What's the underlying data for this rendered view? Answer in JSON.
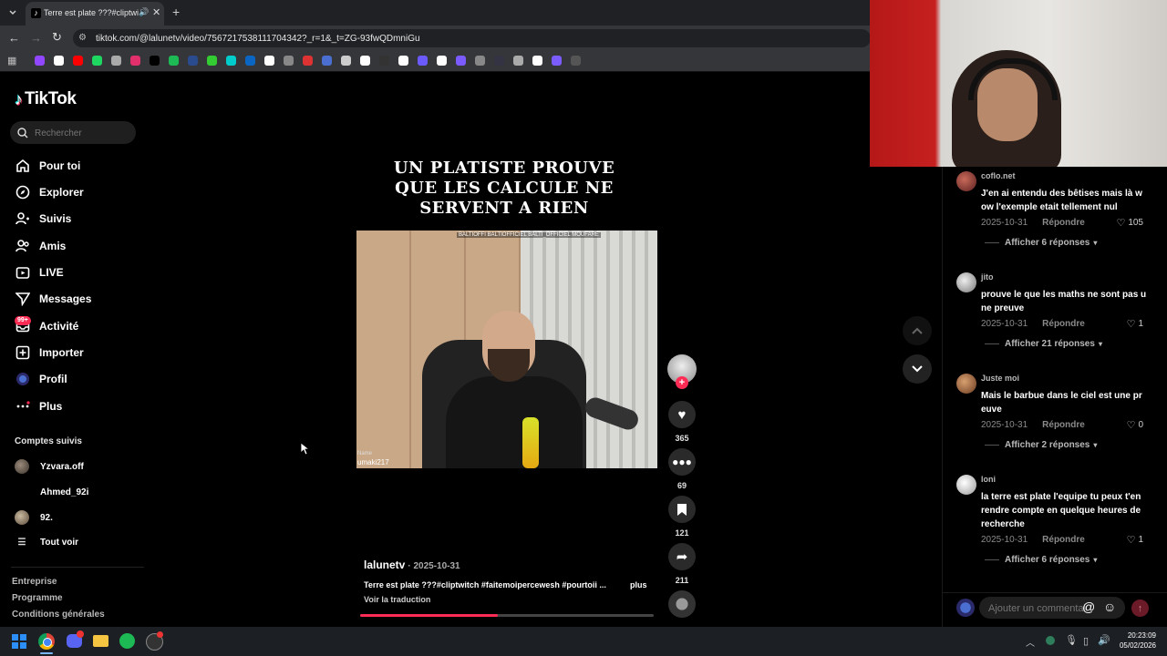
{
  "browser": {
    "tab_title": "Terre est plate ???#cliptwitc",
    "url": "tiktok.com/@lalunetv/video/7567217538111704342?_r=1&_t=ZG-93fwQDmniGu"
  },
  "sidebar": {
    "logo": "TikTok",
    "search_placeholder": "Rechercher",
    "nav": [
      {
        "label": "Pour toi",
        "icon": "home-icon"
      },
      {
        "label": "Explorer",
        "icon": "compass-icon"
      },
      {
        "label": "Suivis",
        "icon": "user-follow-icon"
      },
      {
        "label": "Amis",
        "icon": "friends-icon"
      },
      {
        "label": "LIVE",
        "icon": "live-icon"
      },
      {
        "label": "Messages",
        "icon": "send-icon"
      },
      {
        "label": "Activité",
        "icon": "inbox-icon",
        "badge": "99+"
      },
      {
        "label": "Importer",
        "icon": "plus-square-icon"
      },
      {
        "label": "Profil",
        "icon": "profile-avatar-icon"
      },
      {
        "label": "Plus",
        "icon": "more-dots-icon"
      }
    ],
    "following_title": "Comptes suivis",
    "following": [
      "Yzvara.off",
      "Ahmed_92i",
      "92."
    ],
    "see_all": "Tout voir",
    "footer": [
      "Entreprise",
      "Programme",
      "Conditions générales"
    ]
  },
  "video": {
    "caption_lines": [
      "UN PLATISTE PROUVE",
      "QUE LES CALCULE NE",
      "SERVENT A RIEN"
    ],
    "overlay_banner": "BALTIOFFI  BALTIOFFICIEL  BALTI_OFFICIEL  MOUFARE",
    "overlay_name_label": "Name",
    "overlay_name": "umaki217",
    "author": "lalunetv",
    "date": "· 2025-10-31",
    "description": "Terre est plate ???#cliptwitch #faitemoipercewesh #pourtoii ...",
    "more": "plus",
    "translate": "Voir la traduction",
    "progress": 0.47,
    "likes": "365",
    "comments": "69",
    "saves": "121",
    "shares": "211"
  },
  "comments": {
    "list": [
      {
        "user": "coflo.net",
        "text": "J'en ai entendu des bêtises mais là w ow l'exemple etait tellement nul",
        "date": "2025-10-31",
        "reply": "Répondre",
        "likes": "105",
        "more": "Afficher 6 réponses"
      },
      {
        "user": "jito",
        "text": "prouve le que les maths ne sont pas u ne preuve",
        "date": "2025-10-31",
        "reply": "Répondre",
        "likes": "1",
        "more": "Afficher 21 réponses"
      },
      {
        "user": "Juste moi",
        "text": "Mais le barbue dans le ciel est une pr euve",
        "date": "2025-10-31",
        "reply": "Répondre",
        "likes": "0",
        "more": "Afficher 2 réponses"
      },
      {
        "user": "loni",
        "text": "la terre est plate l'equipe tu peux t'en rendre compte en quelque heures de recherche",
        "date": "2025-10-31",
        "reply": "Répondre",
        "likes": "1",
        "more": "Afficher 6 réponses"
      }
    ],
    "input_placeholder": "Ajouter un commentaire..."
  },
  "taskbar": {
    "time": "20:23:09",
    "date": "05/02/2026"
  },
  "colors": {
    "accent": "#fe2c55",
    "background": "#000000"
  }
}
